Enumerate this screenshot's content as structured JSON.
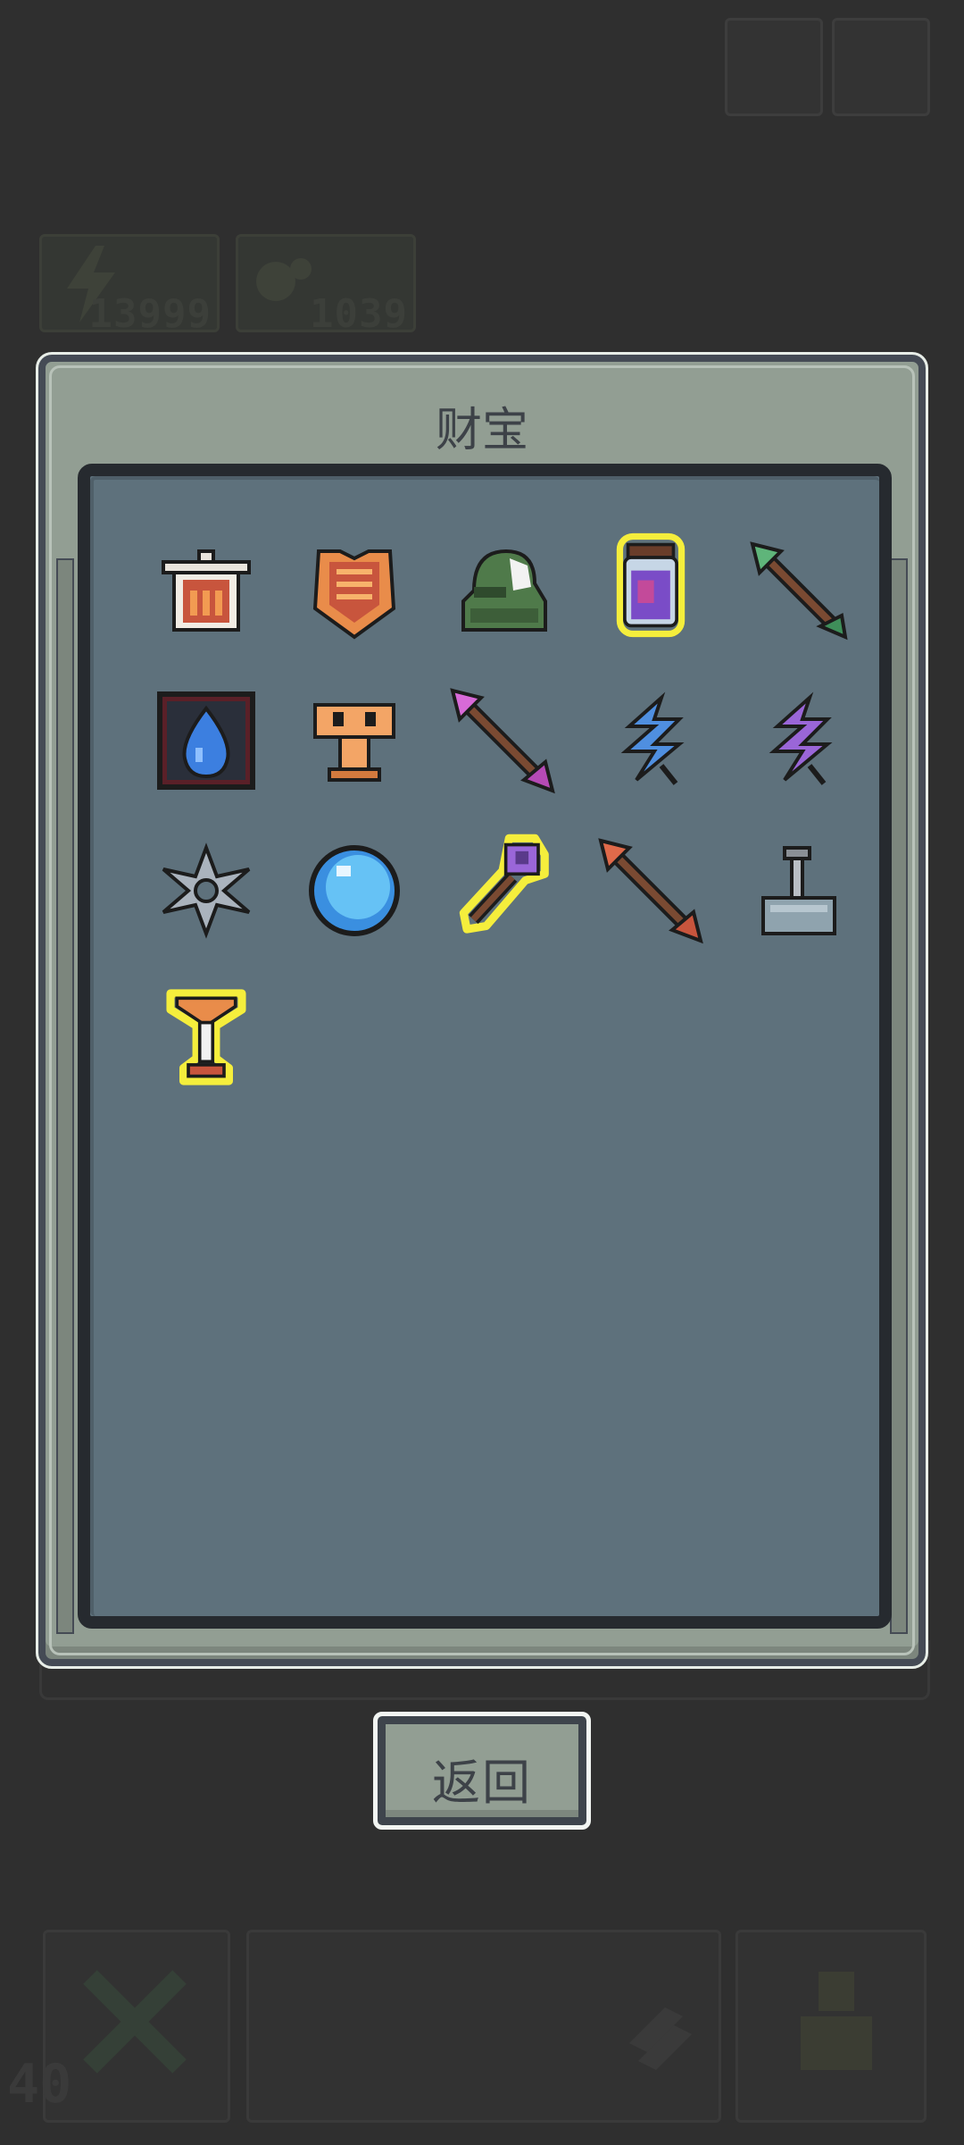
{
  "header": {
    "energy_value": "13999",
    "gem_value": "1039"
  },
  "dialog": {
    "title": "财宝",
    "back_label": "返回"
  },
  "level": "40",
  "treasures": [
    {
      "icon": "bucket-hat-icon"
    },
    {
      "icon": "orange-armor-icon"
    },
    {
      "icon": "green-helmet-icon"
    },
    {
      "icon": "potion-jar-icon"
    },
    {
      "icon": "green-arrow-icon"
    },
    {
      "icon": "water-drop-tile-icon"
    },
    {
      "icon": "orange-totem-icon"
    },
    {
      "icon": "pink-arrow-icon"
    },
    {
      "icon": "blue-feather-icon"
    },
    {
      "icon": "purple-feather-icon"
    },
    {
      "icon": "steel-shuriken-icon"
    },
    {
      "icon": "blue-orb-icon"
    },
    {
      "icon": "purple-wrench-icon"
    },
    {
      "icon": "red-arrow-icon"
    },
    {
      "icon": "stone-sword-pedestal-icon"
    },
    {
      "icon": "golden-goblet-icon"
    }
  ],
  "colors": {
    "background": "#2f2f2f",
    "dialog": "#929e93",
    "panel": "#5e717c",
    "rare_highlight": "#f5ee3c"
  }
}
